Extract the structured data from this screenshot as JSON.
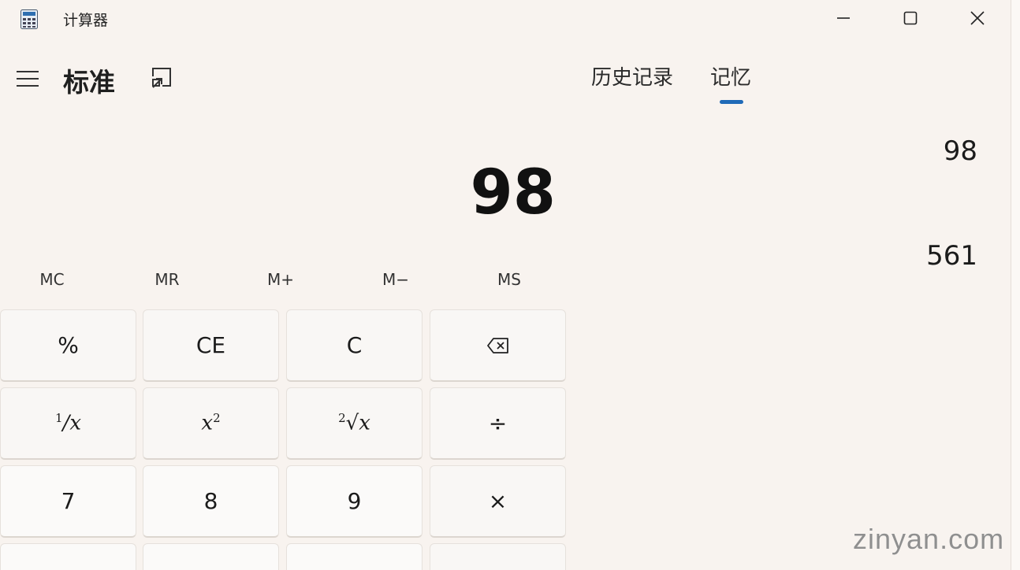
{
  "window": {
    "title": "计算器",
    "controls": {
      "minimize": "minimize",
      "maximize": "maximize",
      "close": "close"
    }
  },
  "header": {
    "mode_title": "标准",
    "menu_icon": "hamburger-icon",
    "keep_on_top_icon": "keep-on-top-icon"
  },
  "tabs": [
    {
      "label": "历史记录",
      "selected": false
    },
    {
      "label": "记忆",
      "selected": true
    }
  ],
  "colors": {
    "accent": "#1f6ab8",
    "background": "#f8f3ef",
    "key": "#fbfaf9"
  },
  "display": {
    "value": "98"
  },
  "memory": {
    "items": [
      "98",
      "561"
    ]
  },
  "memory_buttons": [
    "MC",
    "MR",
    "M+",
    "M−",
    "MS"
  ],
  "keypad": {
    "row1": {
      "percent": "%",
      "clear_entry": "CE",
      "clear": "C",
      "backspace": "backspace-icon"
    },
    "row2": {
      "reciprocal_num": "1",
      "reciprocal_den": "x",
      "square_base": "x",
      "square_exp": "2",
      "sqrt_index": "2",
      "sqrt_radicand": "x",
      "divide": "÷"
    },
    "row3": {
      "seven": "7",
      "eight": "8",
      "nine": "9",
      "multiply": "×"
    }
  },
  "watermark": "zinyan.com"
}
